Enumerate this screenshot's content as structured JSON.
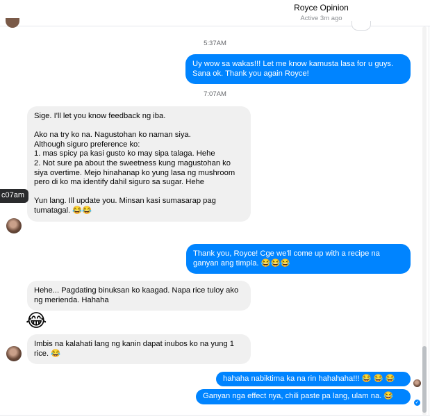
{
  "header": {
    "contact_name": "Royce Opinion",
    "status": "Active 3m ago"
  },
  "thread": {
    "timestamps": [
      "5:37AM",
      "7:07AM"
    ],
    "hover_time": "c07am",
    "messages": [
      {
        "from": "me",
        "text": "Uy wow sa wakas!!! Let me know kamusta lasa for u guys. Sana ok. Thank you again Royce!"
      },
      {
        "from": "them",
        "text": "Sige. I'll let you know feedback ng iba.\n\nAko na try ko na. Nagustohan ko naman siya.\nAlthough siguro preference ko:\n1. mas spicy pa kasi gusto ko may sipa talaga. Hehe\n2. Not sure pa about the sweetness kung magustohan ko siya overtime. Mejo hinahanap ko yung lasa ng mushroom pero di ko ma identify dahil siguro sa sugar. Hehe\n\nYun lang. Ill update you. Minsan kasi sumasarap pag tumatagal. 😂😂"
      },
      {
        "from": "me",
        "text": "Thank you, Royce! Cge we'll come up with a recipe na ganyan ang timpla. 😂😂😂"
      },
      {
        "from": "them",
        "text": "Hehe... Pagdating binuksan ko kaagad. Napa rice tuloy ako ng merienda. Hahaha"
      },
      {
        "from": "them",
        "text": "😂"
      },
      {
        "from": "them",
        "text": "Imbis na kalahati lang ng kanin dapat inubos ko na yung 1 rice. 😂"
      },
      {
        "from": "me",
        "text": "hahaha nabiktima ka na rin hahahaha!!! 😂 😂 😂"
      },
      {
        "from": "me",
        "text": "Ganyan nga effect nya, chili paste pa lang, ulam na. 😂"
      }
    ]
  },
  "icons": {
    "read_receipt": "check-icon",
    "big_emoji": "laughing-tears-emoji"
  },
  "colors": {
    "outgoing_bubble": "#0084ff",
    "incoming_bubble": "#f0f0f0"
  }
}
